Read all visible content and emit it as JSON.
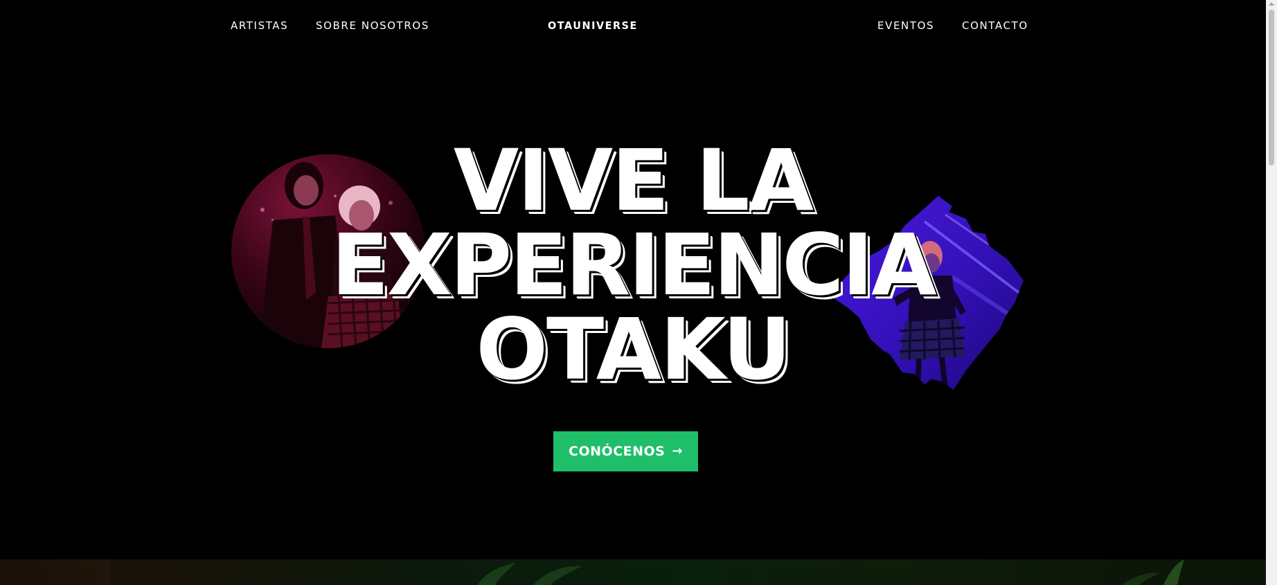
{
  "nav": {
    "left_links": [
      "ARTISTAS",
      "SOBRE NOSOTROS"
    ],
    "right_links": [
      "EVENTOS",
      "CONTACTO"
    ],
    "logo": "OTAUNIVERSE"
  },
  "hero": {
    "title_lines": [
      "VIVE LA",
      "EXPERIENCIA",
      "OTAKU"
    ],
    "cta_label": "CONÓCENOS",
    "cta_icon": "arrow-right-icon",
    "accent_color": "#1fbe69",
    "left_image": "cosplay-duo-red-photo",
    "right_image": "cosplay-dancer-purple-photo"
  }
}
